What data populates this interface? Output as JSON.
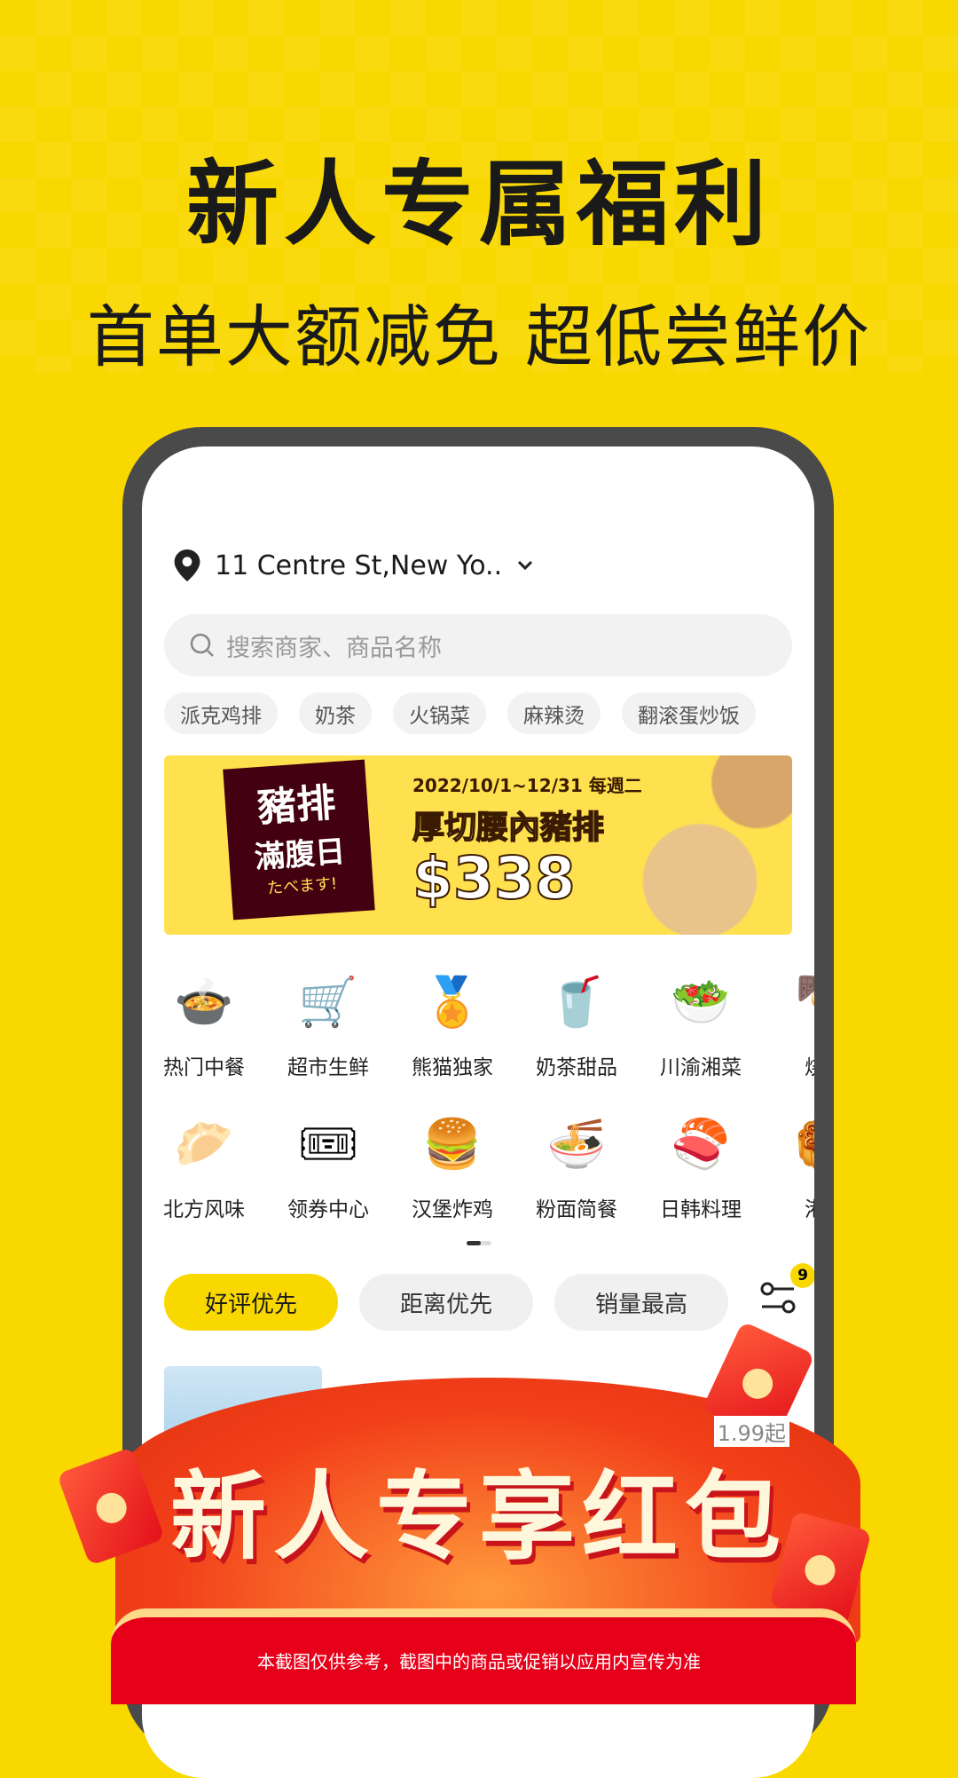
{
  "headline": "新人专属福利",
  "subheadline": "首单大额减免 超低尝鲜价",
  "app": {
    "location": "11 Centre St,New Yo..",
    "search_placeholder": "搜索商家、商品名称",
    "chips": [
      "派克鸡排",
      "奶茶",
      "火锅菜",
      "麻辣烫",
      "翻滚蛋炒饭"
    ],
    "banner": {
      "badge_line1": "豬排",
      "badge_line2": "滿腹日",
      "badge_line3": "たべます!",
      "date": "2022/10/1~12/31 每週二",
      "name": "厚切腰內豬排",
      "price": "$338"
    },
    "categories_row1": [
      {
        "label": "热门中餐",
        "icon": "🍲"
      },
      {
        "label": "超市生鲜",
        "icon": "🛒"
      },
      {
        "label": "熊猫独家",
        "icon": "🏅"
      },
      {
        "label": "奶茶甜品",
        "icon": "🥤"
      },
      {
        "label": "川渝湘菜",
        "icon": "🥗"
      },
      {
        "label": "烧烤",
        "icon": "🍢"
      }
    ],
    "categories_row2": [
      {
        "label": "北方风味",
        "icon": "🥟"
      },
      {
        "label": "领券中心",
        "icon": "🎟"
      },
      {
        "label": "汉堡炸鸡",
        "icon": "🍔"
      },
      {
        "label": "粉面简餐",
        "icon": "🍜"
      },
      {
        "label": "日韩料理",
        "icon": "🍣"
      },
      {
        "label": "港台",
        "icon": "🥮"
      }
    ],
    "sorts": [
      "好评优先",
      "距离优先",
      "销量最高"
    ],
    "filter_badge": "9",
    "price_partial": "1.99起"
  },
  "promo": {
    "title": "新人专享红包",
    "note": "本截图仅供参考，截图中的商品或促销以应用内宣传为准"
  },
  "colors": {
    "brand_yellow": "#f9d800",
    "promo_red": "#e7001a"
  }
}
